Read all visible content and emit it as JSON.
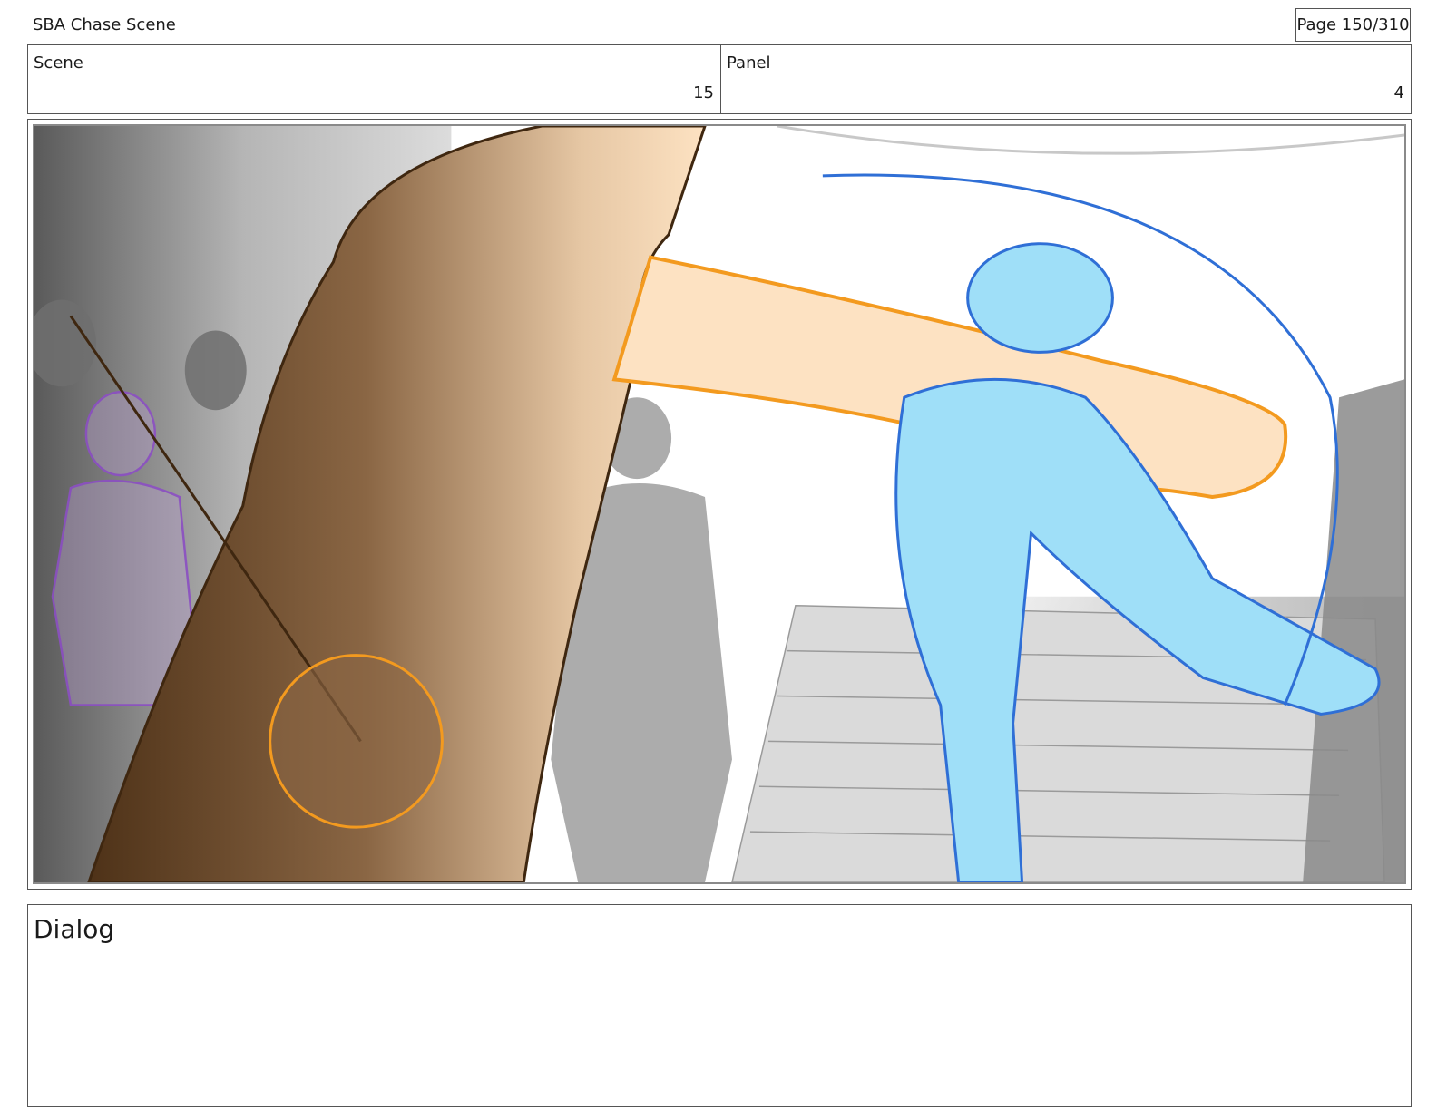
{
  "document": {
    "title": "SBA Chase Scene",
    "page_label": "Page 150/310"
  },
  "info": {
    "scene_label": "Scene",
    "scene_value": "15",
    "panel_label": "Panel",
    "panel_value": "4"
  },
  "dialog": {
    "label": "Dialog"
  },
  "colors": {
    "foreground_figure": "#7a5230",
    "arm_highlight": "#f39a1f",
    "kicker": "#9fdff8",
    "kicker_line": "#2f6fd6",
    "bystander": "#8c4fc4",
    "background": "#b7b7b7"
  }
}
